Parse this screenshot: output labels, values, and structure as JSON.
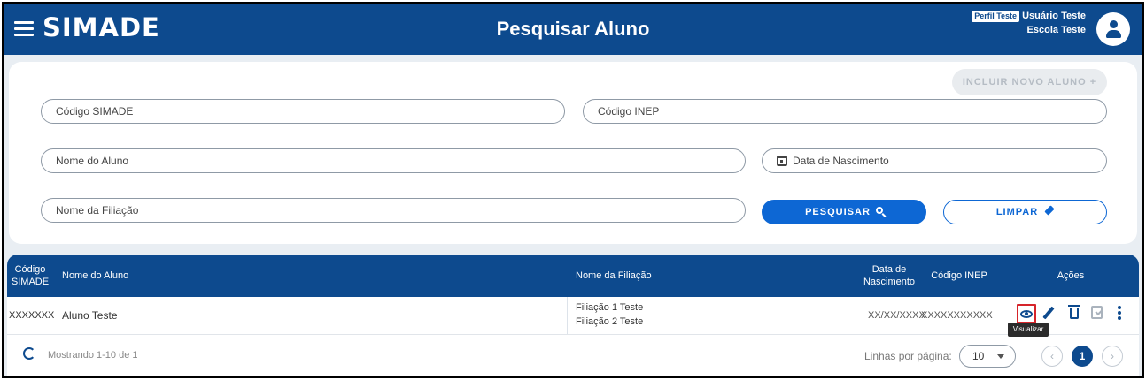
{
  "header": {
    "logo": "SIMADE",
    "title": "Pesquisar Aluno",
    "profile_badge": "Perfil Teste",
    "user_name": "Usuário Teste",
    "school": "Escola Teste"
  },
  "filters": {
    "include_button": "INCLUIR NOVO ALUNO  +",
    "codigo_simade": "Código SIMADE",
    "codigo_inep": "Código INEP",
    "nome_aluno": "Nome do Aluno",
    "data_nascimento": "Data de Nascimento",
    "nome_filiacao": "Nome da Filiação",
    "search_button": "PESQUISAR",
    "clear_button": "LIMPAR"
  },
  "table": {
    "columns": {
      "codigo_simade_1": "Código",
      "codigo_simade_2": "SIMADE",
      "nome_aluno": "Nome do Aluno",
      "nome_filiacao": "Nome da Filiação",
      "data_nasc_1": "Data de",
      "data_nasc_2": "Nascimento",
      "codigo_inep": "Código INEP",
      "acoes": "Ações"
    },
    "rows": [
      {
        "codigo_simade": "XXXXXXX",
        "nome": "Aluno Teste",
        "filiacao_1": "Filiação 1 Teste",
        "filiacao_2": "Filiação 2 Teste",
        "data_nascimento": "XX/XX/XXXX",
        "codigo_inep": "XXXXXXXXXXX"
      }
    ],
    "tooltip": "Visualizar"
  },
  "footer": {
    "showing": "Mostrando 1-10 de 1",
    "rows_per_page_label": "Linhas por página:",
    "rows_per_page_value": "10",
    "prev": "‹",
    "current_page": "1",
    "next": "›"
  },
  "icons": [
    "menu-icon",
    "user-avatar-icon",
    "calendar-icon",
    "search-icon",
    "eraser-icon",
    "eye-icon",
    "pencil-icon",
    "trash-icon",
    "checklist-icon",
    "kebab-menu-icon",
    "refresh-icon",
    "chevron-down-icon"
  ],
  "colors": {
    "primary": "#0d4a8e",
    "button_blue": "#0d67d4",
    "highlight_red": "#d6242a",
    "background": "#e9eef3"
  }
}
